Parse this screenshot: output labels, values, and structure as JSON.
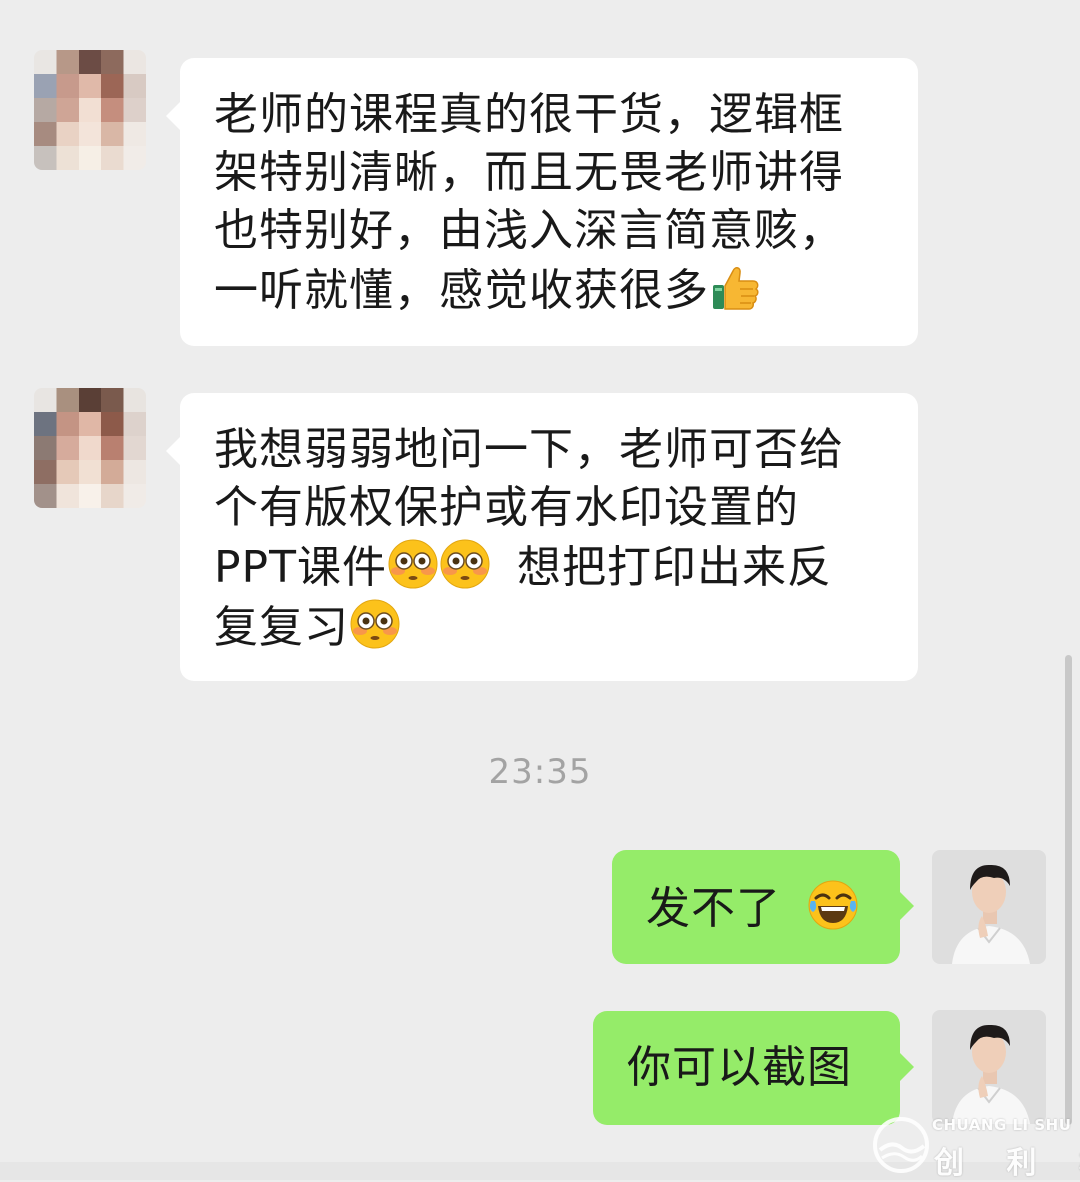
{
  "messages": [
    {
      "direction": "incoming",
      "lines": [
        "老师的课程真的很干货，逻辑框",
        "架特别清晰，而且无畏老师讲得",
        "也特别好，由浅入深言简意赅，",
        "一听就懂，感觉收获很多"
      ],
      "trailing_emoji": "thumbs-up"
    },
    {
      "direction": "incoming",
      "lines": [
        "我想弱弱地问一下，老师可否给",
        "个有版权保护或有水印设置的",
        "PPT课件",
        "想把打印出来反",
        "复复习"
      ],
      "emojis": [
        "flushed-face",
        "flushed-face",
        "flushed-face"
      ]
    },
    {
      "direction": "outgoing",
      "text": "发不了",
      "trailing_emoji": "tears-of-joy"
    },
    {
      "direction": "outgoing",
      "text": "你可以截图"
    }
  ],
  "timestamp": "23:35",
  "watermark": {
    "english": "CHUANG LI SHU",
    "chinese": "创 利 树"
  },
  "colors": {
    "background": "#ededed",
    "incoming_bubble": "#ffffff",
    "outgoing_bubble": "#95ec69",
    "timestamp_text": "#a3a3a3"
  }
}
